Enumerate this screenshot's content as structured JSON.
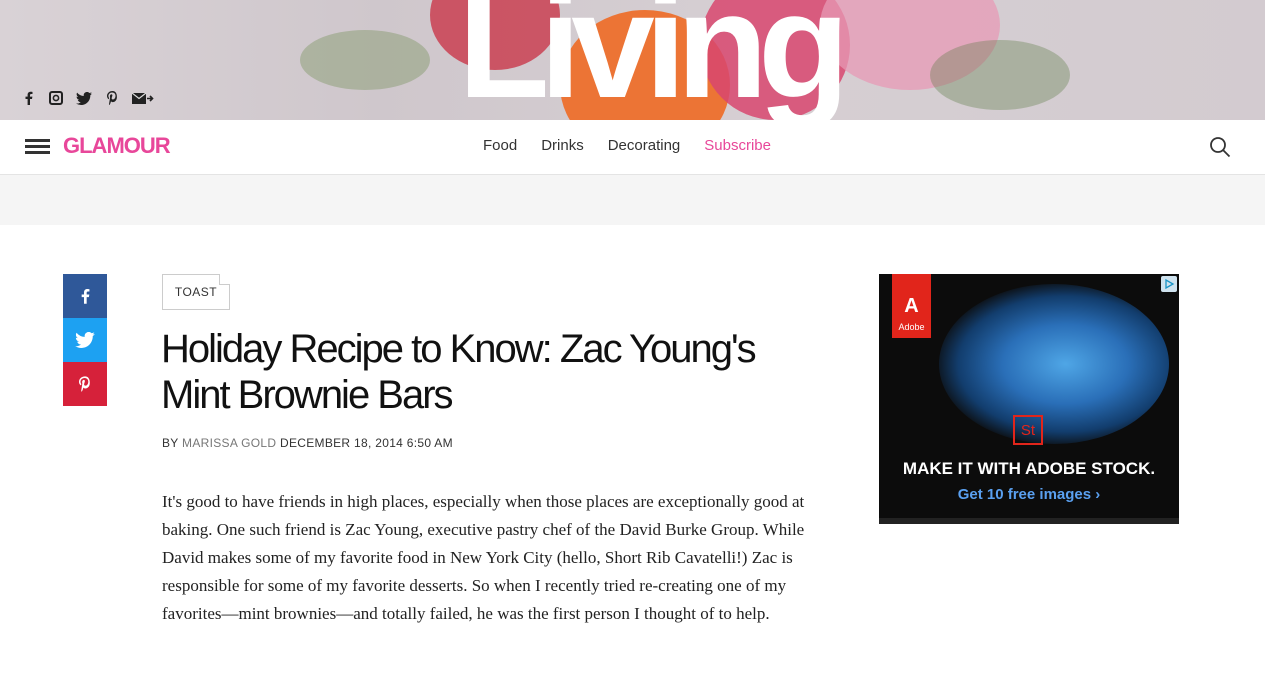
{
  "hero": {
    "title": "Living"
  },
  "social": [
    "facebook-icon",
    "instagram-icon",
    "twitter-icon",
    "pinterest-icon",
    "email-icon"
  ],
  "nav": {
    "logo": "GLAMOUR",
    "links": [
      "Food",
      "Drinks",
      "Decorating",
      "Subscribe"
    ]
  },
  "article": {
    "tag": "TOAST",
    "headline": "Holiday Recipe to Know: Zac Young's Mint Brownie Bars",
    "by": "BY",
    "author": "MARISSA GOLD",
    "date": "DECEMBER 18, 2014 6:50 AM",
    "body": "It's good to have friends in high places, especially when those places are exceptionally good at baking. One such friend is Zac Young, executive pastry chef of the David Burke Group. While David makes some of my favorite food in New York City (hello, Short Rib Cavatelli!) Zac is responsible for some of my favorite desserts. So when I recently tried re-creating one of my favorites—mint brownies—and totally failed, he was the first person I thought of to help."
  },
  "ad": {
    "brand": "Adobe",
    "brand_mark": "A",
    "product_mark": "St",
    "headline": "MAKE IT WITH ADOBE STOCK.",
    "cta": "Get 10 free images ›"
  },
  "colors": {
    "brand": "#e8479a",
    "facebook": "#2f5899",
    "twitter": "#1da1f2",
    "pinterest": "#d6213a"
  }
}
